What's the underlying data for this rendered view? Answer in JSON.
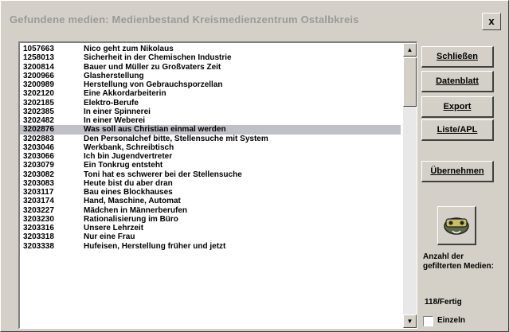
{
  "window": {
    "title": "Gefundene medien: Medienbestand Kreismedienzentrum Ostalbkreis",
    "close_label": "x"
  },
  "list": {
    "items": [
      {
        "number": "1057663",
        "title": "Nico geht zum Nikolaus"
      },
      {
        "number": "1258013",
        "title": "Sicherheit in der Chemischen Industrie"
      },
      {
        "number": "3200814",
        "title": "Bauer und Müller zu Großvaters Zeit"
      },
      {
        "number": "3200966",
        "title": "Glasherstellung"
      },
      {
        "number": "3200989",
        "title": "Herstellung von Gebrauchsporzellan"
      },
      {
        "number": "3202120",
        "title": "Eine Akkordarbeiterin"
      },
      {
        "number": "3202185",
        "title": "Elektro-Berufe"
      },
      {
        "number": "3202385",
        "title": "In einer Spinnerei"
      },
      {
        "number": "3202482",
        "title": "In einer Weberei"
      },
      {
        "number": "3202876",
        "title": "Was soll aus Christian einmal werden"
      },
      {
        "number": "3202883",
        "title": "Den Personalchef bitte, Stellensuche mit System"
      },
      {
        "number": "3203046",
        "title": "Werkbank, Schreibtisch"
      },
      {
        "number": "3203066",
        "title": "Ich bin Jugendvertreter"
      },
      {
        "number": "3203079",
        "title": "Ein Tonkrug entsteht"
      },
      {
        "number": "3203082",
        "title": "Toni hat es schwerer bei der Stellensuche"
      },
      {
        "number": "3203083",
        "title": "Heute bist du aber dran"
      },
      {
        "number": "3203117",
        "title": "Bau eines Blockhauses"
      },
      {
        "number": "3203174",
        "title": "Hand, Maschine, Automat"
      },
      {
        "number": "3203227",
        "title": "Mädchen in Männerberufen"
      },
      {
        "number": "3203230",
        "title": "Rationalisierung im Büro"
      },
      {
        "number": "3203316",
        "title": "Unsere Lehrzeit"
      },
      {
        "number": "3203318",
        "title": "Nur eine Frau"
      },
      {
        "number": "3203338",
        "title": "Hufeisen, Herstellung früher und jetzt"
      }
    ],
    "selected_index": 9
  },
  "buttons": {
    "close": "Schließen",
    "datasheet": "Datenblatt",
    "export": "Export",
    "list_apl": "Liste/APL",
    "take_over": "Übernehmen"
  },
  "status": {
    "count_label": "Anzahl der gefilterten Medien:",
    "count_value": "118/Fertig",
    "single_label": "Einzeln",
    "single_checked": false
  },
  "icons": {
    "media": "cassette-icon",
    "scroll_up": "arrow-up-icon",
    "scroll_down": "arrow-down-icon",
    "close": "close-icon"
  }
}
